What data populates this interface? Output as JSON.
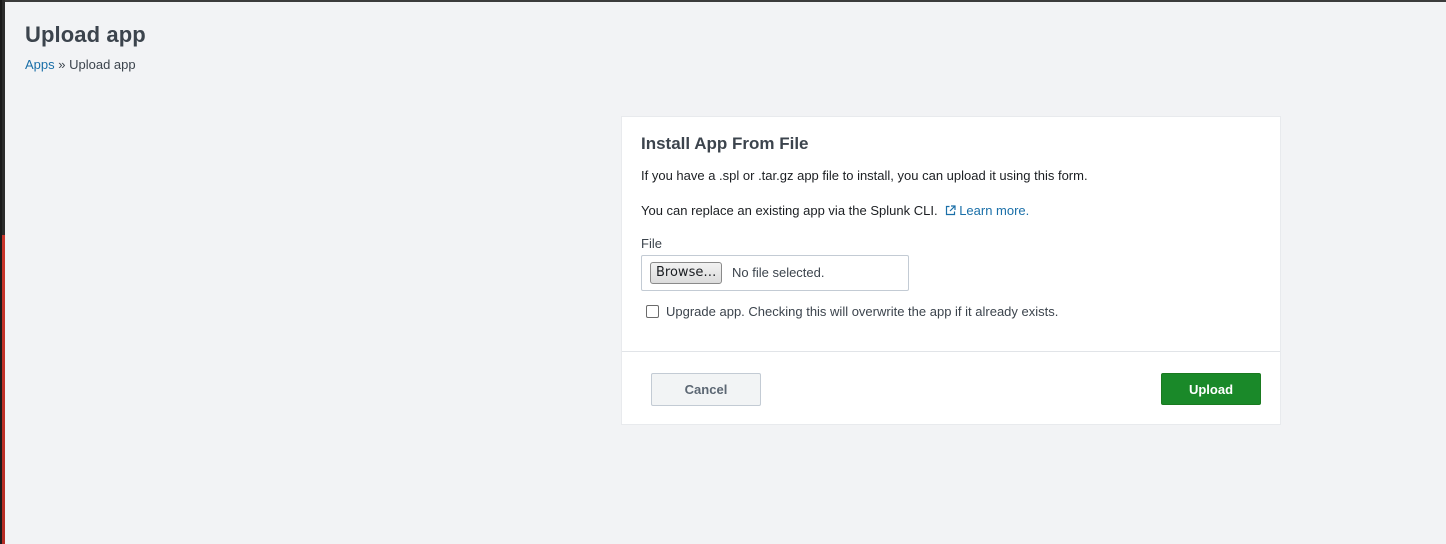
{
  "page": {
    "title": "Upload app"
  },
  "breadcrumb": {
    "apps_link": "Apps",
    "separator": " » ",
    "current": "Upload app"
  },
  "panel": {
    "title": "Install App From File",
    "intro": "If you have a .spl or .tar.gz app file to install, you can upload it using this form.",
    "cli_text": "You can replace an existing app via the Splunk CLI.",
    "learn_more": "Learn more.",
    "file_label": "File",
    "browse_label": "Browse…",
    "no_file_text": "No file selected.",
    "upgrade_label": "Upgrade app. Checking this will overwrite the app if it already exists.",
    "upgrade_checked": false
  },
  "footer": {
    "cancel_label": "Cancel",
    "upload_label": "Upload"
  },
  "colors": {
    "link": "#1a6fa8",
    "primary": "#1a8929",
    "background": "#f2f3f5"
  },
  "icons": {
    "learn_more": "external-link-icon"
  }
}
